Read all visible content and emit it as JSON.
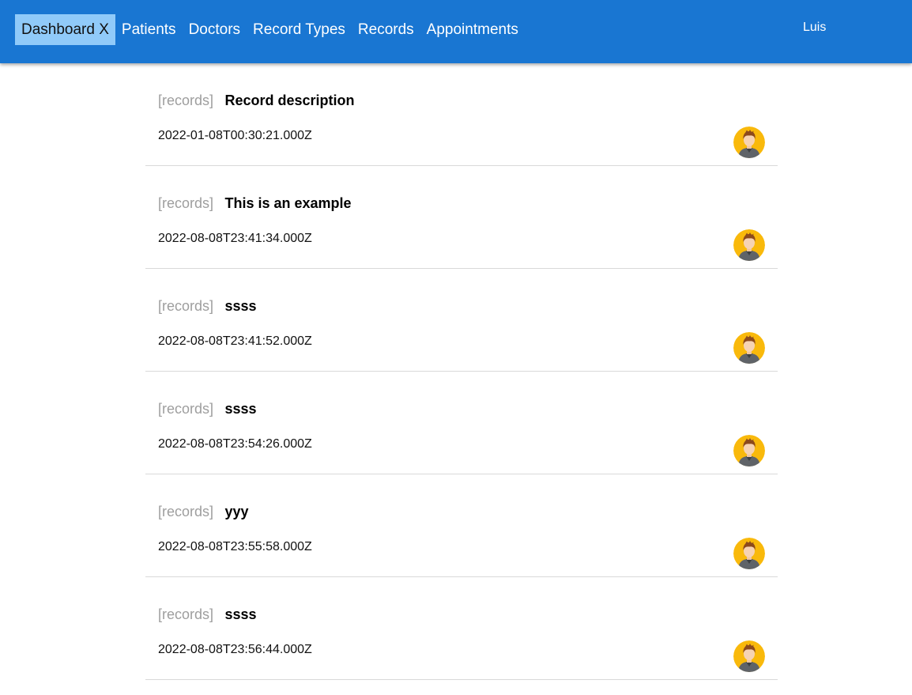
{
  "colors": {
    "navbar_bg": "#1976d2",
    "nav_active_bg": "#90caf9",
    "avatar_bg": "#f9b90b",
    "tag_text": "#9e9e9e",
    "divider": "#d9d9d9"
  },
  "nav": {
    "items": [
      {
        "label": "Dashboard X",
        "active": true
      },
      {
        "label": "Patients",
        "active": false
      },
      {
        "label": "Doctors",
        "active": false
      },
      {
        "label": "Record Types",
        "active": false
      },
      {
        "label": "Records",
        "active": false
      },
      {
        "label": "Appointments",
        "active": false
      }
    ],
    "user": "Luis"
  },
  "records": [
    {
      "tag": "[records]",
      "description": "Record description",
      "date": "2022-01-08T00:30:21.000Z",
      "avatar_icon": "user-avatar-icon"
    },
    {
      "tag": "[records]",
      "description": "This is an example",
      "date": "2022-08-08T23:41:34.000Z",
      "avatar_icon": "user-avatar-icon"
    },
    {
      "tag": "[records]",
      "description": "ssss",
      "date": "2022-08-08T23:41:52.000Z",
      "avatar_icon": "user-avatar-icon"
    },
    {
      "tag": "[records]",
      "description": "ssss",
      "date": "2022-08-08T23:54:26.000Z",
      "avatar_icon": "user-avatar-icon"
    },
    {
      "tag": "[records]",
      "description": "yyy",
      "date": "2022-08-08T23:55:58.000Z",
      "avatar_icon": "user-avatar-icon"
    },
    {
      "tag": "[records]",
      "description": "ssss",
      "date": "2022-08-08T23:56:44.000Z",
      "avatar_icon": "user-avatar-icon"
    }
  ]
}
